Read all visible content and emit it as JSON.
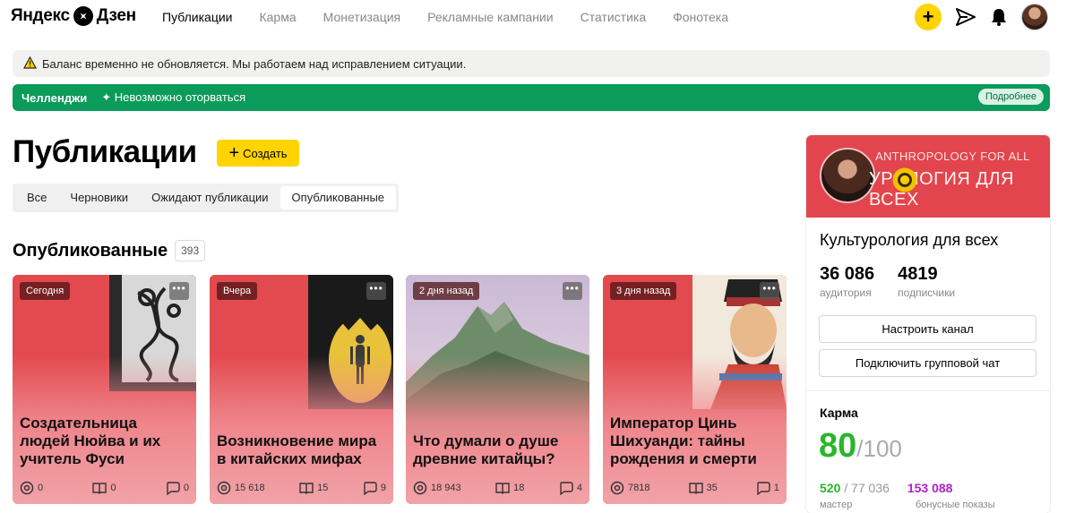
{
  "logo": {
    "left": "Яндекс",
    "right": "Дзен"
  },
  "nav": [
    "Публикации",
    "Карма",
    "Монетизация",
    "Рекламные кампании",
    "Статистика",
    "Фонотека"
  ],
  "notice": "Баланс временно не обновляется. Мы работаем над исправлением ситуации.",
  "challenge": {
    "title": "Челленджи",
    "text": "✦ Невозможно оторваться",
    "more": "Подробнее"
  },
  "page": {
    "title": "Публикации",
    "create": "Создать"
  },
  "tabs": [
    "Все",
    "Черновики",
    "Ожидают публикации",
    "Опубликованные"
  ],
  "section": {
    "title": "Опубликованные",
    "count": "393"
  },
  "cards": [
    {
      "date": "Сегодня",
      "title": "Создательница людей Нюйва и их учитель Фуси",
      "views": "0",
      "reads": "0",
      "comments": "0"
    },
    {
      "date": "Вчера",
      "title": "Возникновение мира в китайских мифах",
      "views": "15 618",
      "reads": "15",
      "comments": "9"
    },
    {
      "date": "2 дня назад",
      "title": "Что думали о душе древние китайцы?",
      "views": "18 943",
      "reads": "18",
      "comments": "4"
    },
    {
      "date": "3 дня назад",
      "title": "Император Цинь Шихуанди: тайны рождения и смерти",
      "views": "7818",
      "reads": "35",
      "comments": "1"
    }
  ],
  "sidebar": {
    "banner_top": "ANTHROPOLOGY FOR ALL",
    "banner_bottom": "УРОЛОГИЯ ДЛЯ ВСЕХ",
    "channel": "Культурология для всех",
    "audience": "36 086",
    "audience_label": "аудитория",
    "subscribers": "4819",
    "subscribers_label": "подписчики",
    "btn_configure": "Настроить канал",
    "btn_chat": "Подключить групповой чат",
    "karma_title": "Карма",
    "karma_value": "80",
    "karma_max": "/100",
    "master_value": "520",
    "master_max": " / 77 036",
    "master_label": "мастер",
    "bonus_value": "153 088",
    "bonus_label": "бонусные показы"
  },
  "colors": {
    "accent": "#ffd400",
    "challenge": "#0b9b5a",
    "card": "#e2454d",
    "karma": "#2ab62a",
    "bonus": "#b020c8"
  }
}
